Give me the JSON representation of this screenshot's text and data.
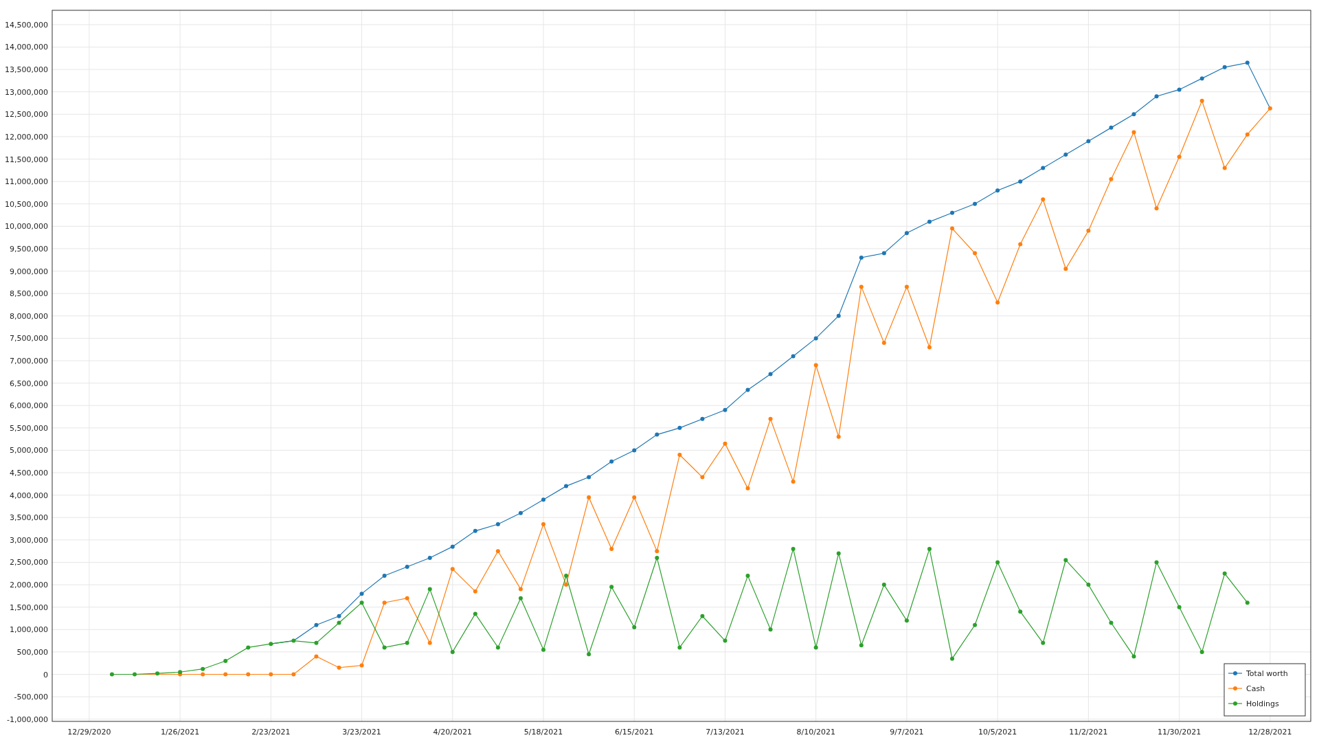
{
  "chart": {
    "chart_data": {
      "type": "line",
      "ylim": [
        -1050000,
        14820000
      ],
      "grid": true,
      "legend": true,
      "categories": [
        "12/29/2020",
        null,
        null,
        null,
        "1/26/2021",
        null,
        null,
        null,
        "2/23/2021",
        null,
        null,
        null,
        "3/23/2021",
        null,
        null,
        null,
        "4/20/2021",
        null,
        null,
        null,
        "5/18/2021",
        null,
        null,
        null,
        "6/15/2021",
        null,
        null,
        null,
        "7/13/2021",
        null,
        null,
        null,
        "8/10/2021",
        null,
        null,
        null,
        "9/7/2021",
        null,
        null,
        null,
        "10/5/2021",
        null,
        null,
        null,
        "11/2/2021",
        null,
        null,
        null,
        "11/30/2021",
        null,
        null,
        null,
        "12/28/2021"
      ],
      "series": [
        {
          "name": "Total worth",
          "color": "#1f77b4",
          "marker": "circle",
          "values": [
            null,
            null,
            null,
            null,
            null,
            null,
            null,
            null,
            680000,
            750000,
            1100000,
            1300000,
            1800000,
            2200000,
            2400000,
            2600000,
            2850000,
            3200000,
            3350000,
            3600000,
            3900000,
            4200000,
            4400000,
            4750000,
            5000000,
            5350000,
            5500000,
            5700000,
            5900000,
            6350000,
            6700000,
            7100000,
            7500000,
            8000000,
            9300000,
            9400000,
            9850000,
            10100000,
            10300000,
            10500000,
            10800000,
            11000000,
            11300000,
            11600000,
            11900000,
            12200000,
            12500000,
            12900000,
            13050000,
            13300000,
            13550000,
            13650000,
            12630000
          ]
        },
        {
          "name": "Cash",
          "color": "#ff7f0e",
          "marker": "circle",
          "values": [
            null,
            0,
            0,
            0,
            0,
            0,
            0,
            0,
            0,
            0,
            400000,
            150000,
            200000,
            1600000,
            1700000,
            700000,
            2350000,
            1850000,
            2750000,
            1900000,
            3350000,
            2000000,
            3950000,
            2800000,
            3950000,
            2750000,
            4900000,
            4400000,
            5150000,
            4150000,
            5700000,
            4300000,
            6900000,
            5300000,
            8650000,
            7400000,
            8650000,
            7300000,
            9950000,
            9400000,
            8300000,
            9600000,
            10600000,
            9050000,
            9900000,
            11050000,
            12100000,
            10400000,
            11550000,
            12800000,
            11300000,
            12050000,
            12630000
          ]
        },
        {
          "name": "Holdings",
          "color": "#2ca02c",
          "marker": "circle",
          "values": [
            null,
            0,
            0,
            20000,
            50000,
            120000,
            300000,
            600000,
            680000,
            750000,
            700000,
            1150000,
            1600000,
            600000,
            700000,
            1900000,
            500000,
            1350000,
            600000,
            1700000,
            550000,
            2200000,
            450000,
            1950000,
            1050000,
            2600000,
            600000,
            1300000,
            750000,
            2200000,
            1000000,
            2800000,
            600000,
            2700000,
            650000,
            2000000,
            1200000,
            2800000,
            350000,
            1100000,
            2500000,
            1400000,
            700000,
            2550000,
            2000000,
            1150000,
            400000,
            2500000,
            1500000,
            500000,
            2250000,
            1600000,
            null
          ]
        }
      ],
      "yticks": [
        {
          "value": -1000000,
          "label": "-1,000,000"
        },
        {
          "value": -500000,
          "label": "-500,000"
        },
        {
          "value": 0,
          "label": "0"
        },
        {
          "value": 500000,
          "label": "500,000"
        },
        {
          "value": 1000000,
          "label": "1,000,000"
        },
        {
          "value": 1500000,
          "label": "1,500,000"
        },
        {
          "value": 2000000,
          "label": "2,000,000"
        },
        {
          "value": 2500000,
          "label": "2,500,000"
        },
        {
          "value": 3000000,
          "label": "3,000,000"
        },
        {
          "value": 3500000,
          "label": "3,500,000"
        },
        {
          "value": 4000000,
          "label": "4,000,000"
        },
        {
          "value": 4500000,
          "label": "4,500,000"
        },
        {
          "value": 5000000,
          "label": "5,000,000"
        },
        {
          "value": 5500000,
          "label": "5,500,000"
        },
        {
          "value": 6000000,
          "label": "6,000,000"
        },
        {
          "value": 6500000,
          "label": "6,500,000"
        },
        {
          "value": 7000000,
          "label": "7,000,000"
        },
        {
          "value": 7500000,
          "label": "7,500,000"
        },
        {
          "value": 8000000,
          "label": "8,000,000"
        },
        {
          "value": 8500000,
          "label": "8,500,000"
        },
        {
          "value": 9000000,
          "label": "9,000,000"
        },
        {
          "value": 9500000,
          "label": "9,500,000"
        },
        {
          "value": 10000000,
          "label": "10,000,000"
        },
        {
          "value": 10500000,
          "label": "10,500,000"
        },
        {
          "value": 11000000,
          "label": "11,000,000"
        },
        {
          "value": 11500000,
          "label": "11,500,000"
        },
        {
          "value": 12000000,
          "label": "12,000,000"
        },
        {
          "value": 12500000,
          "label": "12,500,000"
        },
        {
          "value": 13000000,
          "label": "13,000,000"
        },
        {
          "value": 13500000,
          "label": "13,500,000"
        },
        {
          "value": 14000000,
          "label": "14,000,000"
        },
        {
          "value": 14500000,
          "label": "14,500,000"
        }
      ]
    }
  }
}
